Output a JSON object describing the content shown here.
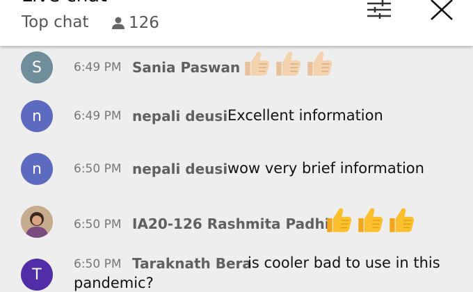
{
  "header": {
    "title": "Live chat",
    "mode": "Top chat",
    "viewers": "126"
  },
  "messages": [
    {
      "avatar_letter": "S",
      "avatar_color": "#708d9a",
      "time": "6:49 PM",
      "author": "Sania Paswan",
      "text": "",
      "emoji": [
        "thumbs-up-light-skin",
        "thumbs-up-light-skin",
        "thumbs-up-light-skin"
      ]
    },
    {
      "avatar_letter": "n",
      "avatar_color": "#5c6bc0",
      "time": "6:49 PM",
      "author": "nepali deusi",
      "text": "Excellent information",
      "emoji": []
    },
    {
      "avatar_letter": "n",
      "avatar_color": "#5c6bc0",
      "time": "6:50 PM",
      "author": "nepali deusi",
      "text": "wow very brief information",
      "emoji": []
    },
    {
      "avatar_letter": "",
      "avatar_color": "#b89a7e",
      "time": "6:50 PM",
      "author": "IA20-126 Rashmita Padhi",
      "text": "",
      "emoji": [
        "thumbs-up",
        "thumbs-up",
        "thumbs-up"
      ]
    },
    {
      "avatar_letter": "T",
      "avatar_color": "#512da8",
      "time": "6:50 PM",
      "author": "Taraknath Bera",
      "text": "is cooler bad to use in this",
      "text_line2": "pandemic?",
      "emoji": []
    }
  ],
  "colors": {
    "background": "#eeeeee",
    "header_bg": "#ffffff",
    "author": "#606060",
    "timestamp": "#777777",
    "thumb_yellow": "#fbc02d",
    "thumb_light": "#f3d2ae"
  },
  "icons": {
    "viewers": "person-icon",
    "filter": "sliders-icon",
    "close": "close-icon"
  }
}
